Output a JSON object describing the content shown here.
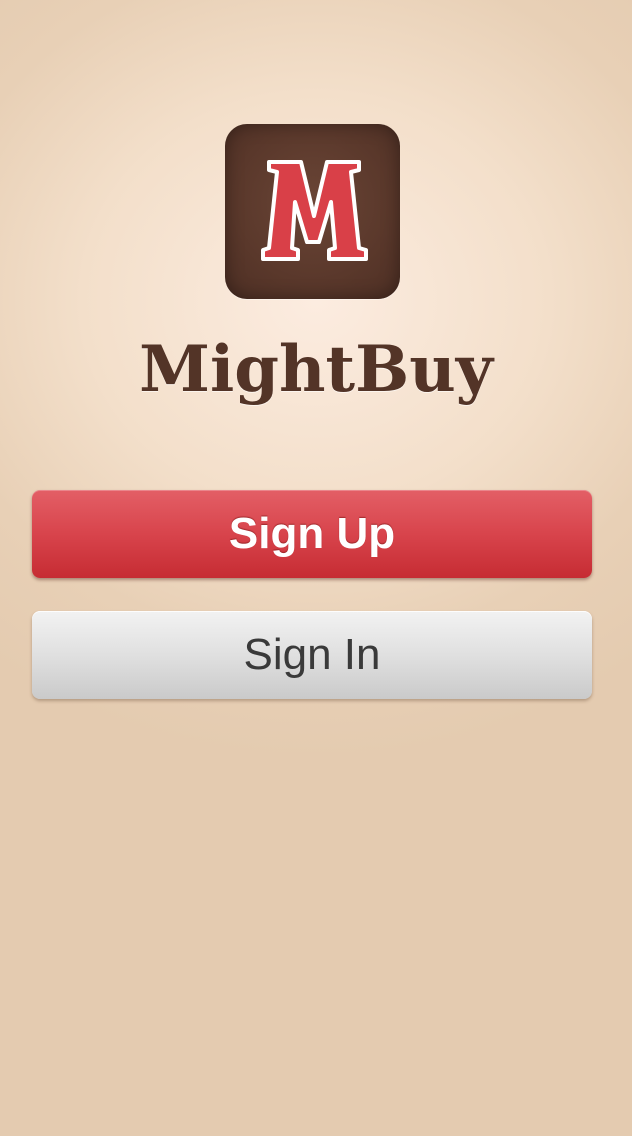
{
  "app": {
    "logo_icon": "mightbuy-m-logo-icon",
    "name": "MightBuy"
  },
  "actions": {
    "sign_up_label": "Sign Up",
    "sign_in_label": "Sign In"
  },
  "colors": {
    "brand_brown": "#533427",
    "accent_red": "#d8444c",
    "button_gray": "#e0e0e0"
  }
}
